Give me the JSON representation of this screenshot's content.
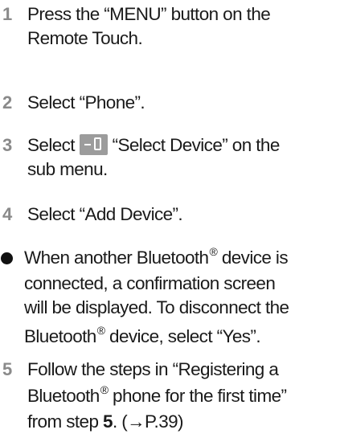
{
  "steps": {
    "s1": {
      "num": "1",
      "line1": "Press the “MENU” button on the",
      "line2": "Remote Touch."
    },
    "s2": {
      "num": "2",
      "line1": "Select “Phone”."
    },
    "s3": {
      "num": "3",
      "prefix": "Select ",
      "icon": "select-device-icon",
      "suffix": "“Select Device” on the",
      "line2": "sub menu."
    },
    "s4": {
      "num": "4",
      "line1": "Select “Add Device”."
    },
    "note": {
      "line1_a": "When another Bluetooth",
      "line1_b": " device is",
      "line2": "connected, a confirmation screen",
      "line3": "will be displayed. To disconnect the",
      "line4_a": "Bluetooth",
      "line4_b": " device, select “Yes”.",
      "reg": "®"
    },
    "s5": {
      "num": "5",
      "line1": "Follow the steps in “Registering a",
      "line2_a": "Bluetooth",
      "line2_b": " phone for the first time”",
      "line3_a": "from step ",
      "line3_step": "5",
      "line3_b": ". (→P.39)",
      "reg": "®"
    }
  },
  "colors": {
    "step_number": "#8a8a8a",
    "text": "#1a1a1a",
    "icon_background": "#9c9c9c"
  }
}
